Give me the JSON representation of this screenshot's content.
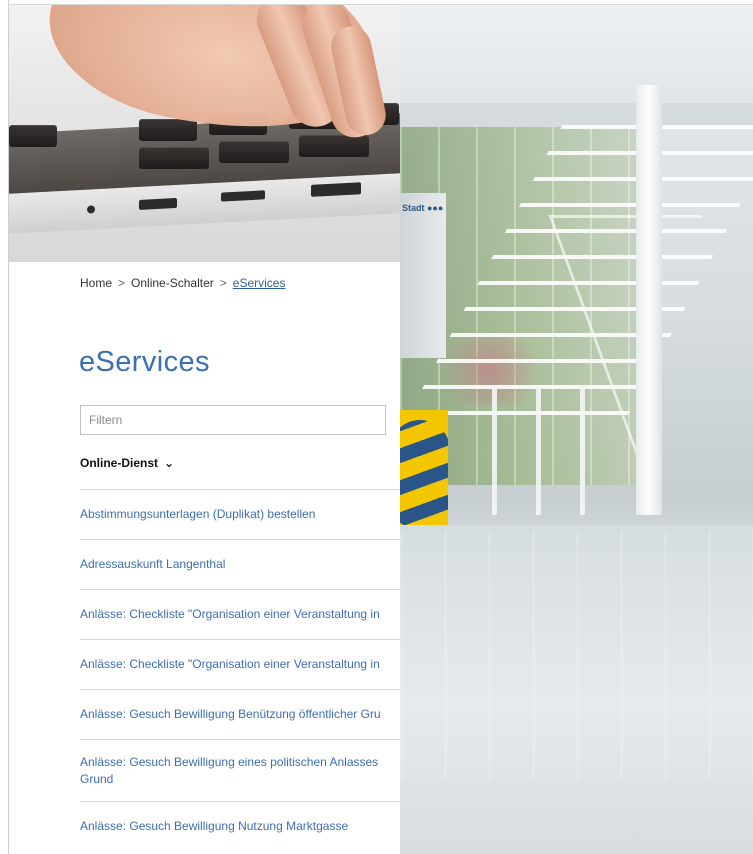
{
  "breadcrumb": {
    "items": [
      "Home",
      "Online-Schalter",
      "eServices"
    ],
    "separator": ">"
  },
  "page": {
    "title": "eServices"
  },
  "filter": {
    "placeholder": "Filtern"
  },
  "table": {
    "column_header": "Online-Dienst"
  },
  "services": [
    "Abstimmungsunterlagen (Duplikat) bestellen",
    "Adressauskunft Langenthal",
    "Anlässe: Checkliste \"Organisation einer Veranstaltung in",
    "Anlässe: Checkliste \"Organisation einer Veranstaltung in",
    "Anlässe: Gesuch Bewilligung Benützung öffentlicher Gru",
    "Anlässe: Gesuch Bewilligung eines politischen Anlasses Grund",
    "Anlässe: Gesuch Bewilligung Nutzung Marktgasse"
  ],
  "photo": {
    "sign_text": "Stadt ●●●"
  },
  "colors": {
    "link": "#3f6fb0",
    "title": "#3b6fb2",
    "border": "#d9d9d9"
  }
}
